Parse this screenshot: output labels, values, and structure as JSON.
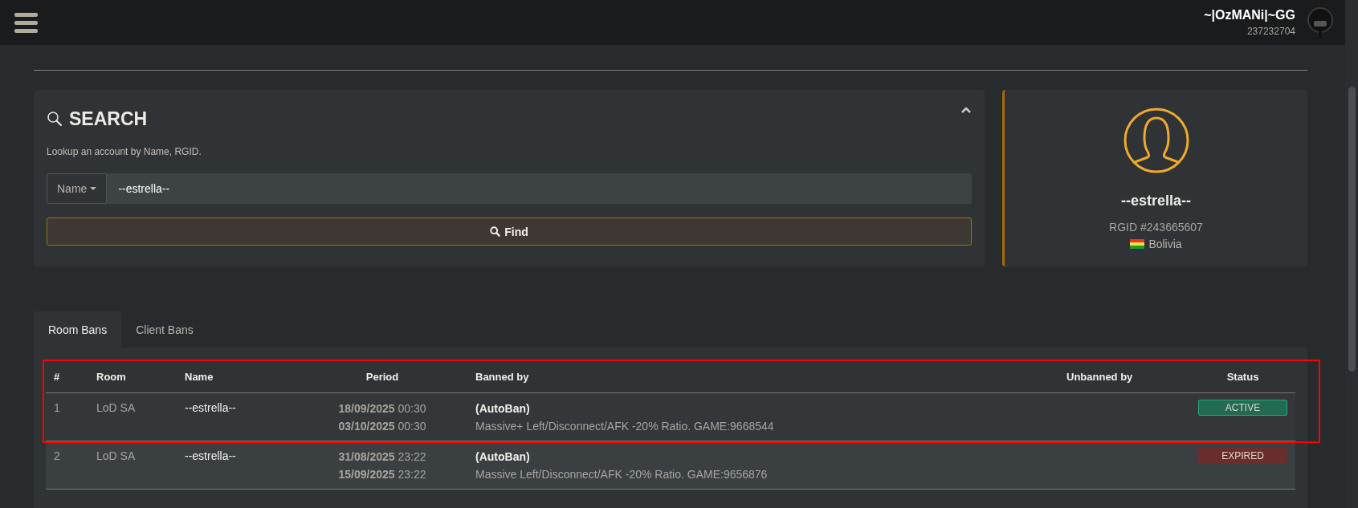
{
  "header": {
    "username": "~|OzMANi|~GG",
    "user_id": "237232704"
  },
  "search": {
    "title": "SEARCH",
    "description": "Lookup an account by Name, RGID.",
    "expanded": true,
    "field_type": "Name",
    "value": "--estrella--",
    "button": "Find"
  },
  "profile": {
    "name": "--estrella--",
    "rgid": "RGID #243665607",
    "country": "Bolivia"
  },
  "tabs": [
    {
      "label": "Room Bans",
      "selected": true
    },
    {
      "label": "Client Bans",
      "selected": false
    }
  ],
  "table": {
    "columns": [
      "#",
      "Room",
      "Name",
      "Period",
      "Banned by",
      "Unbanned by",
      "Status"
    ],
    "rows": [
      {
        "number": "1",
        "room": "LoD SA",
        "name": "--estrella--",
        "start_date": "18/09/2025",
        "start_time": "00:30",
        "end_date": "03/10/2025",
        "end_time": "00:30",
        "banned_by": "(AutoBan)",
        "reason": "Massive+ Left/Disconnect/AFK -20% Ratio. GAME:9668544",
        "status": "ACTIVE",
        "kind": "active",
        "highlighted": true
      },
      {
        "number": "2",
        "room": "LoD SA",
        "name": "--estrella--",
        "start_date": "31/08/2025",
        "start_time": "23:22",
        "end_date": "15/09/2025",
        "end_time": "23:22",
        "banned_by": "(AutoBan)",
        "reason": "Massive Left/Disconnect/AFK -20% Ratio. GAME:9656876",
        "status": "EXPIRED",
        "kind": "expired",
        "highlighted": false
      }
    ]
  }
}
